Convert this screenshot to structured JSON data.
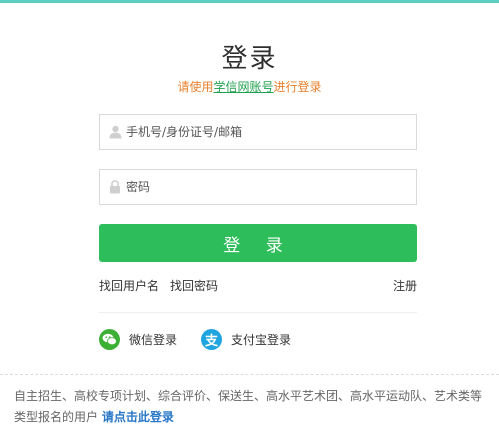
{
  "header": {
    "title": "登录",
    "subtitle_before": "请使用",
    "subtitle_link": "学信网账号",
    "subtitle_after": "进行登录"
  },
  "form": {
    "username_placeholder": "手机号/身份证号/邮箱",
    "username_value": "",
    "password_placeholder": "密码",
    "password_value": "",
    "submit_label": "登 录"
  },
  "links": {
    "recover_username": "找回用户名",
    "recover_password": "找回密码",
    "register": "注册"
  },
  "social": {
    "wechat_label": "微信登录",
    "alipay_label": "支付宝登录",
    "alipay_glyph": "支"
  },
  "footer": {
    "notice_text": "自主招生、高校专项计划、综合评价、保送生、高水平艺术团、高水平运动队、艺术类等类型报名的用户",
    "notice_link": "请点击此登录"
  },
  "colors": {
    "accent_green": "#2dbd5a",
    "subtitle_orange": "#e8802c",
    "link_blue": "#2a78c8",
    "wechat_green": "#3cb034",
    "alipay_blue": "#1ea4e0",
    "top_bar": "#5dcfc0"
  },
  "icons": {
    "username_icon": "user-icon",
    "password_icon": "lock-icon",
    "wechat_icon": "wechat-icon",
    "alipay_icon": "alipay-icon"
  }
}
